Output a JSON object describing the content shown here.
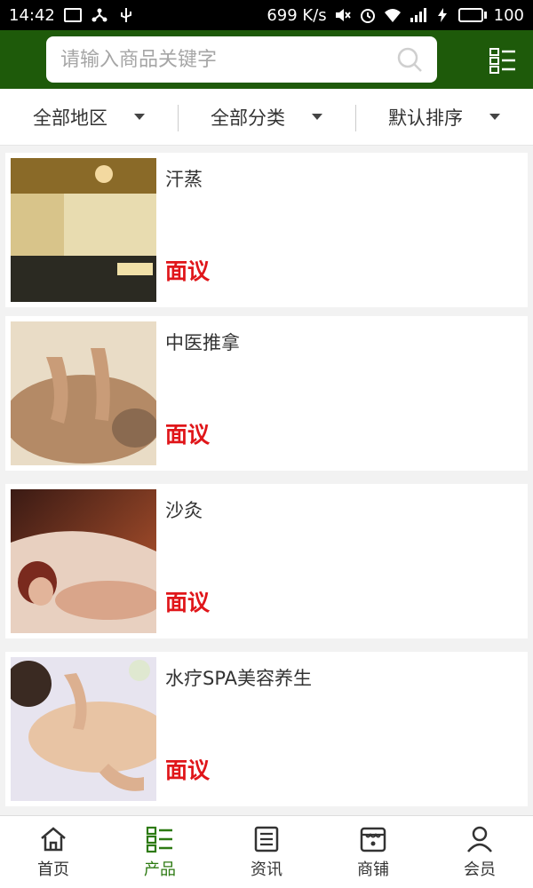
{
  "status_bar": {
    "time": "14:42",
    "speed": "699 K/s",
    "battery": "100"
  },
  "search": {
    "placeholder": "请输入商品关键字"
  },
  "filters": [
    {
      "label": "全部地区"
    },
    {
      "label": "全部分类"
    },
    {
      "label": "默认排序"
    }
  ],
  "products": [
    {
      "title": "汗蒸",
      "price": "面议"
    },
    {
      "title": "中医推拿",
      "price": "面议"
    },
    {
      "title": "沙灸",
      "price": "面议"
    },
    {
      "title": "水疗SPA美容养生",
      "price": "面议"
    }
  ],
  "nav": [
    {
      "label": "首页",
      "icon": "home-icon"
    },
    {
      "label": "产品",
      "icon": "product-list-icon",
      "active": true
    },
    {
      "label": "资讯",
      "icon": "news-icon"
    },
    {
      "label": "商铺",
      "icon": "store-icon"
    },
    {
      "label": "会员",
      "icon": "member-icon"
    }
  ],
  "colors": {
    "header": "#1e5a0a",
    "active_nav": "#2d7a12",
    "price": "#e0161a"
  }
}
